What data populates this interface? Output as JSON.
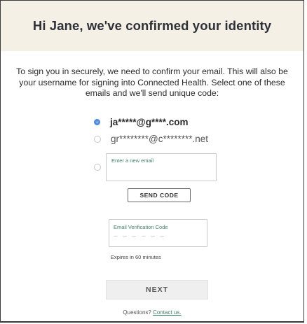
{
  "header": {
    "title": "Hi Jane, we've confirmed your identity"
  },
  "intro": {
    "text": "To sign you in securely, we need to confirm your email. This will also be your username for signing into Connected Health. Select one of these emails and we'll send unique code:"
  },
  "email_options": [
    {
      "label": "ja*****@g****.com",
      "selected": true
    },
    {
      "label": "gr********@c********.net",
      "selected": false
    }
  ],
  "new_email": {
    "placeholder": "Enter a new email",
    "value": ""
  },
  "send_code": {
    "label": "SEND CODE"
  },
  "verification": {
    "label": "Email Verification Code",
    "mask": "– – – – – –",
    "expires": "Expires in 60 minutes"
  },
  "next": {
    "label": "NEXT"
  },
  "footer": {
    "question": "Questions?",
    "contact_label": "Contact us."
  },
  "colors": {
    "header_bg": "#f4f0e5",
    "accent_blue": "#4d88d9",
    "accent_green": "#3f7f68"
  }
}
